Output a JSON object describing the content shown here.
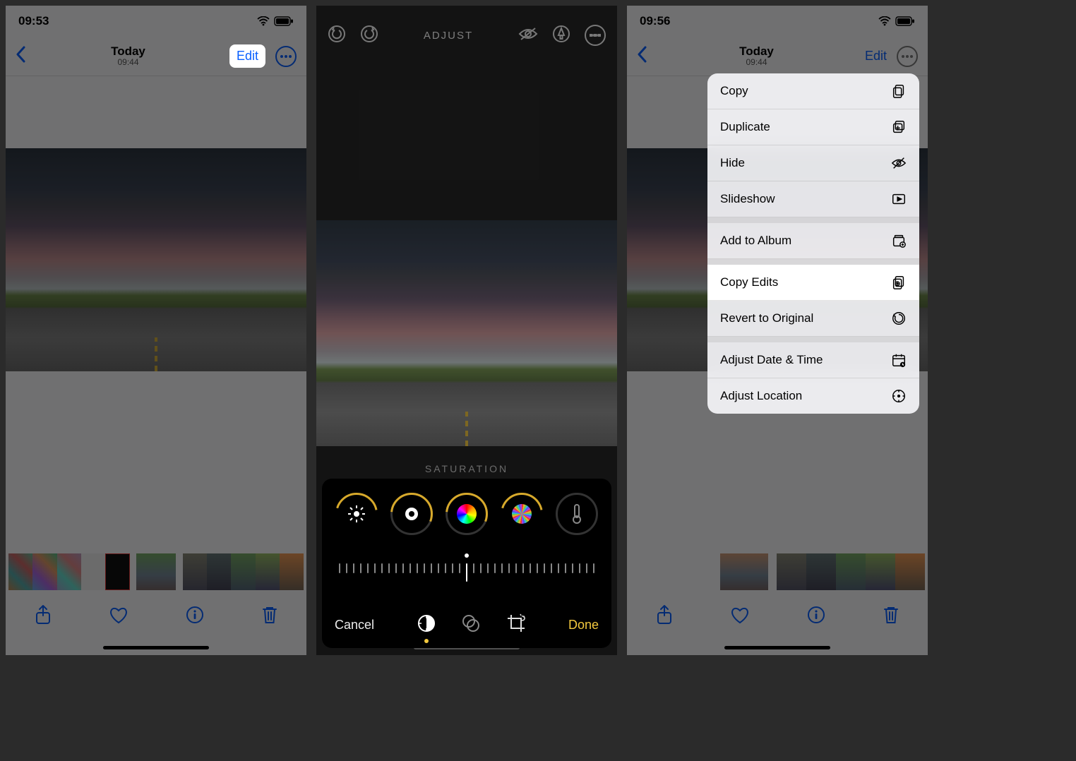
{
  "phone1": {
    "clock": "09:53",
    "nav_title": "Today",
    "nav_sub": "09:44",
    "edit_label": "Edit"
  },
  "phone2": {
    "header_label": "ADJUST",
    "filter_label": "SATURATION",
    "cancel_label": "Cancel",
    "done_label": "Done"
  },
  "phone3": {
    "clock": "09:56",
    "nav_title": "Today",
    "nav_sub": "09:44",
    "edit_label": "Edit",
    "menu": [
      {
        "label": "Copy",
        "sep": false
      },
      {
        "label": "Duplicate",
        "sep": false
      },
      {
        "label": "Hide",
        "sep": false
      },
      {
        "label": "Slideshow",
        "sep": true
      },
      {
        "label": "Add to Album",
        "sep": true
      },
      {
        "label": "Copy Edits",
        "sep": false,
        "highlight": true
      },
      {
        "label": "Revert to Original",
        "sep": true
      },
      {
        "label": "Adjust Date & Time",
        "sep": false
      },
      {
        "label": "Adjust Location",
        "sep": false
      }
    ]
  }
}
